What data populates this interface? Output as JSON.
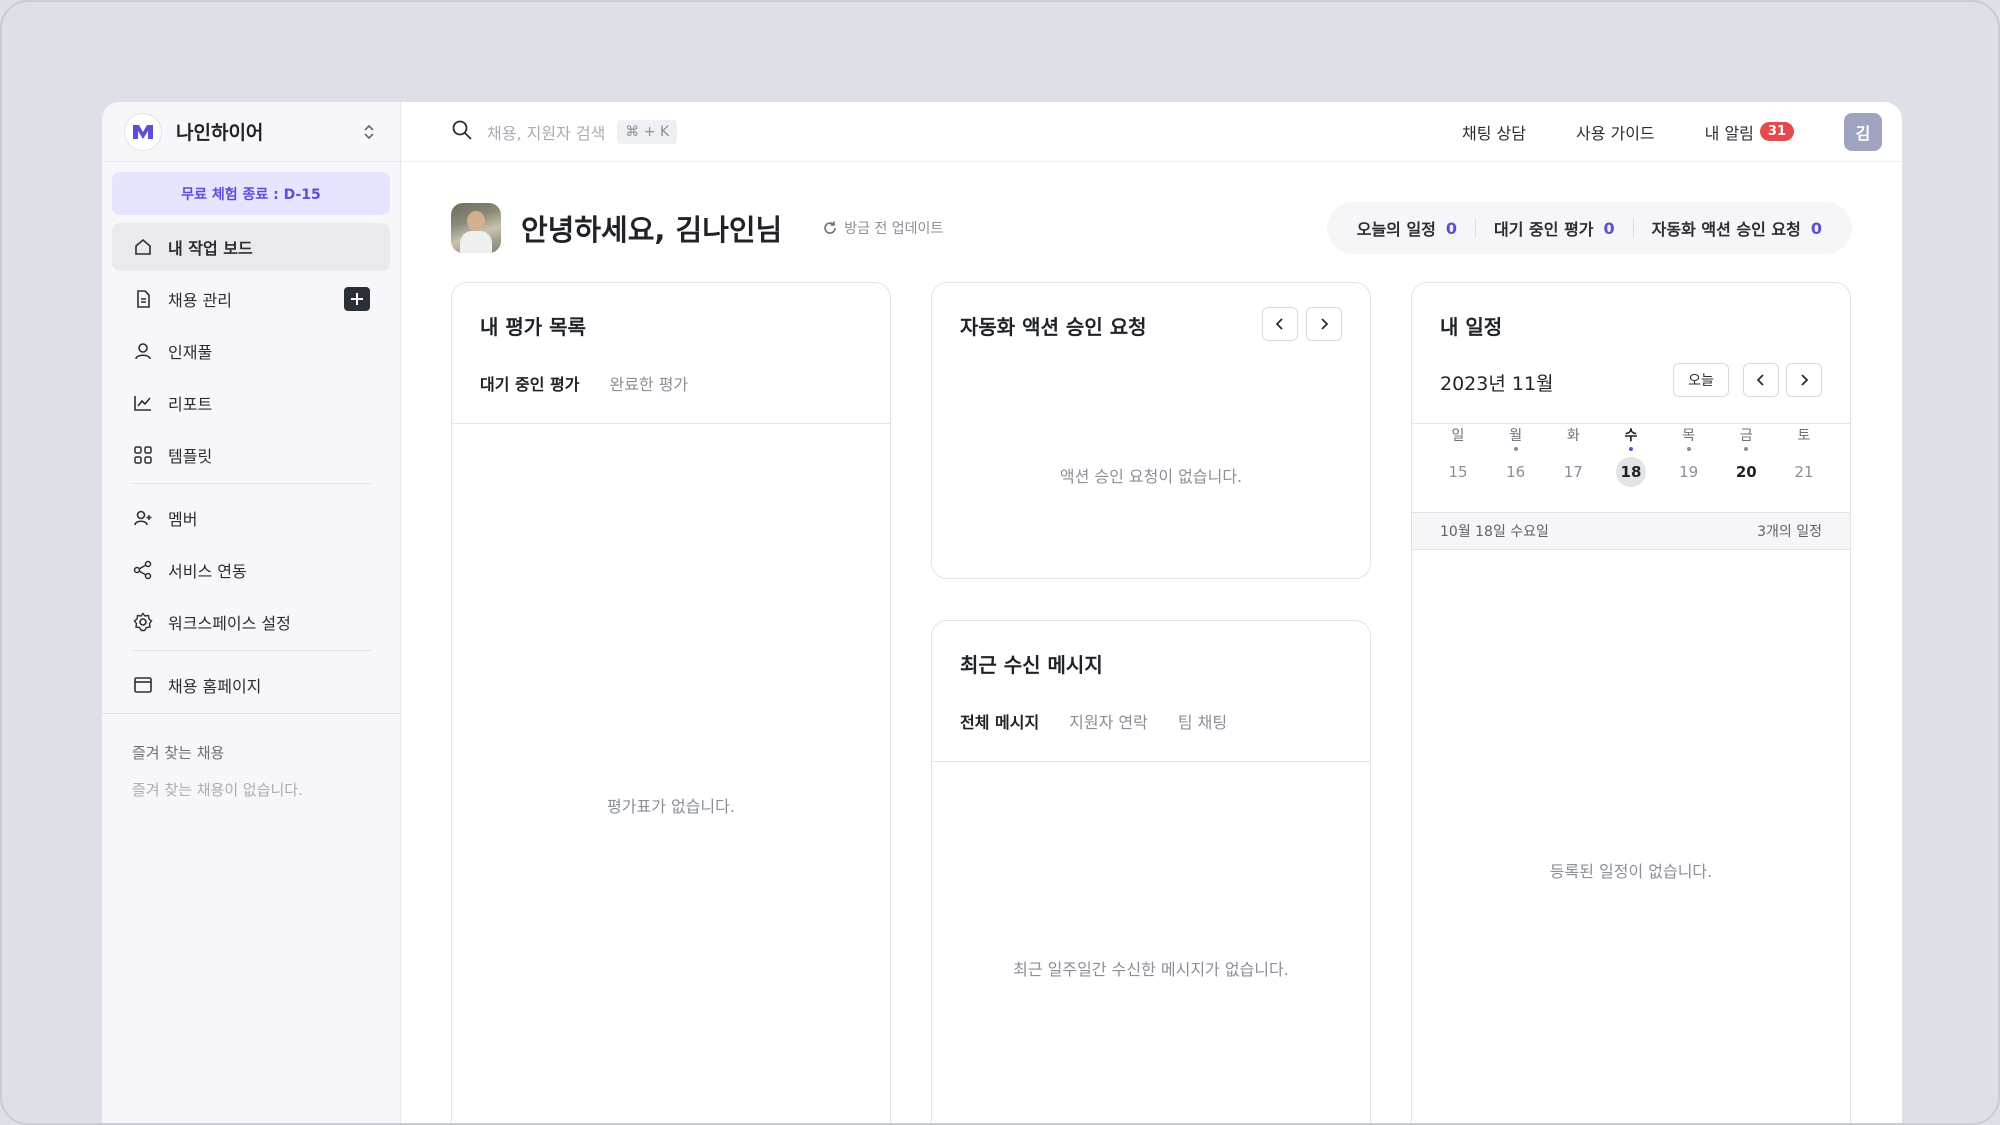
{
  "workspace": {
    "name": "나인하이어"
  },
  "trial": {
    "label": "무료 체험 종료 : D-15"
  },
  "sidebar": {
    "items": [
      {
        "label": "내 작업 보드"
      },
      {
        "label": "채용 관리"
      },
      {
        "label": "인재풀"
      },
      {
        "label": "리포트"
      },
      {
        "label": "템플릿"
      },
      {
        "label": "멤버"
      },
      {
        "label": "서비스 연동"
      },
      {
        "label": "워크스페이스 설정"
      },
      {
        "label": "채용 홈페이지"
      }
    ],
    "favorites_title": "즐겨 찾는 채용",
    "favorites_empty": "즐겨 찾는 채용이 없습니다."
  },
  "search": {
    "placeholder": "채용, 지원자 검색",
    "shortcut": "⌘ + K"
  },
  "topbar": {
    "chat": "채팅 상담",
    "guide": "사용 가이드",
    "alerts": "내 알림",
    "alerts_count": "31",
    "avatar": "김"
  },
  "greeting": {
    "text": "안녕하세요, 김나인님",
    "refresh": "방금 전 업데이트"
  },
  "stats": [
    {
      "label": "오늘의 일정",
      "value": "0"
    },
    {
      "label": "대기 중인 평가",
      "value": "0"
    },
    {
      "label": "자동화 액션 승인 요청",
      "value": "0"
    }
  ],
  "eval_card": {
    "title": "내 평가 목록",
    "tabs": [
      "대기 중인 평가",
      "완료한 평가"
    ],
    "empty": "평가표가 없습니다."
  },
  "automation_card": {
    "title": "자동화 액션 승인 요청",
    "empty": "액션 승인 요청이 없습니다."
  },
  "messages_card": {
    "title": "최근 수신 메시지",
    "tabs": [
      "전체 메시지",
      "지원자 연락",
      "팀 채팅"
    ],
    "empty": "최근 일주일간 수신한 메시지가 없습니다."
  },
  "schedule_card": {
    "title": "내 일정",
    "month": "2023년 11월",
    "today": "오늘",
    "days": [
      {
        "name": "일",
        "num": "15",
        "dot": false
      },
      {
        "name": "월",
        "num": "16",
        "dot": true
      },
      {
        "name": "화",
        "num": "17",
        "dot": false
      },
      {
        "name": "수",
        "num": "18",
        "dot": true
      },
      {
        "name": "목",
        "num": "19",
        "dot": true
      },
      {
        "name": "금",
        "num": "20",
        "dot": true
      },
      {
        "name": "토",
        "num": "21",
        "dot": false
      }
    ],
    "selected_date": "10월 18일 수요일",
    "event_count": "3개의 일정",
    "empty": "등록된 일정이 없습니다."
  },
  "colors": {
    "accent": "#5b4fd6",
    "badge": "#e5484d",
    "dot_today": "#5b4fd6",
    "dot": "#8a8f98"
  }
}
